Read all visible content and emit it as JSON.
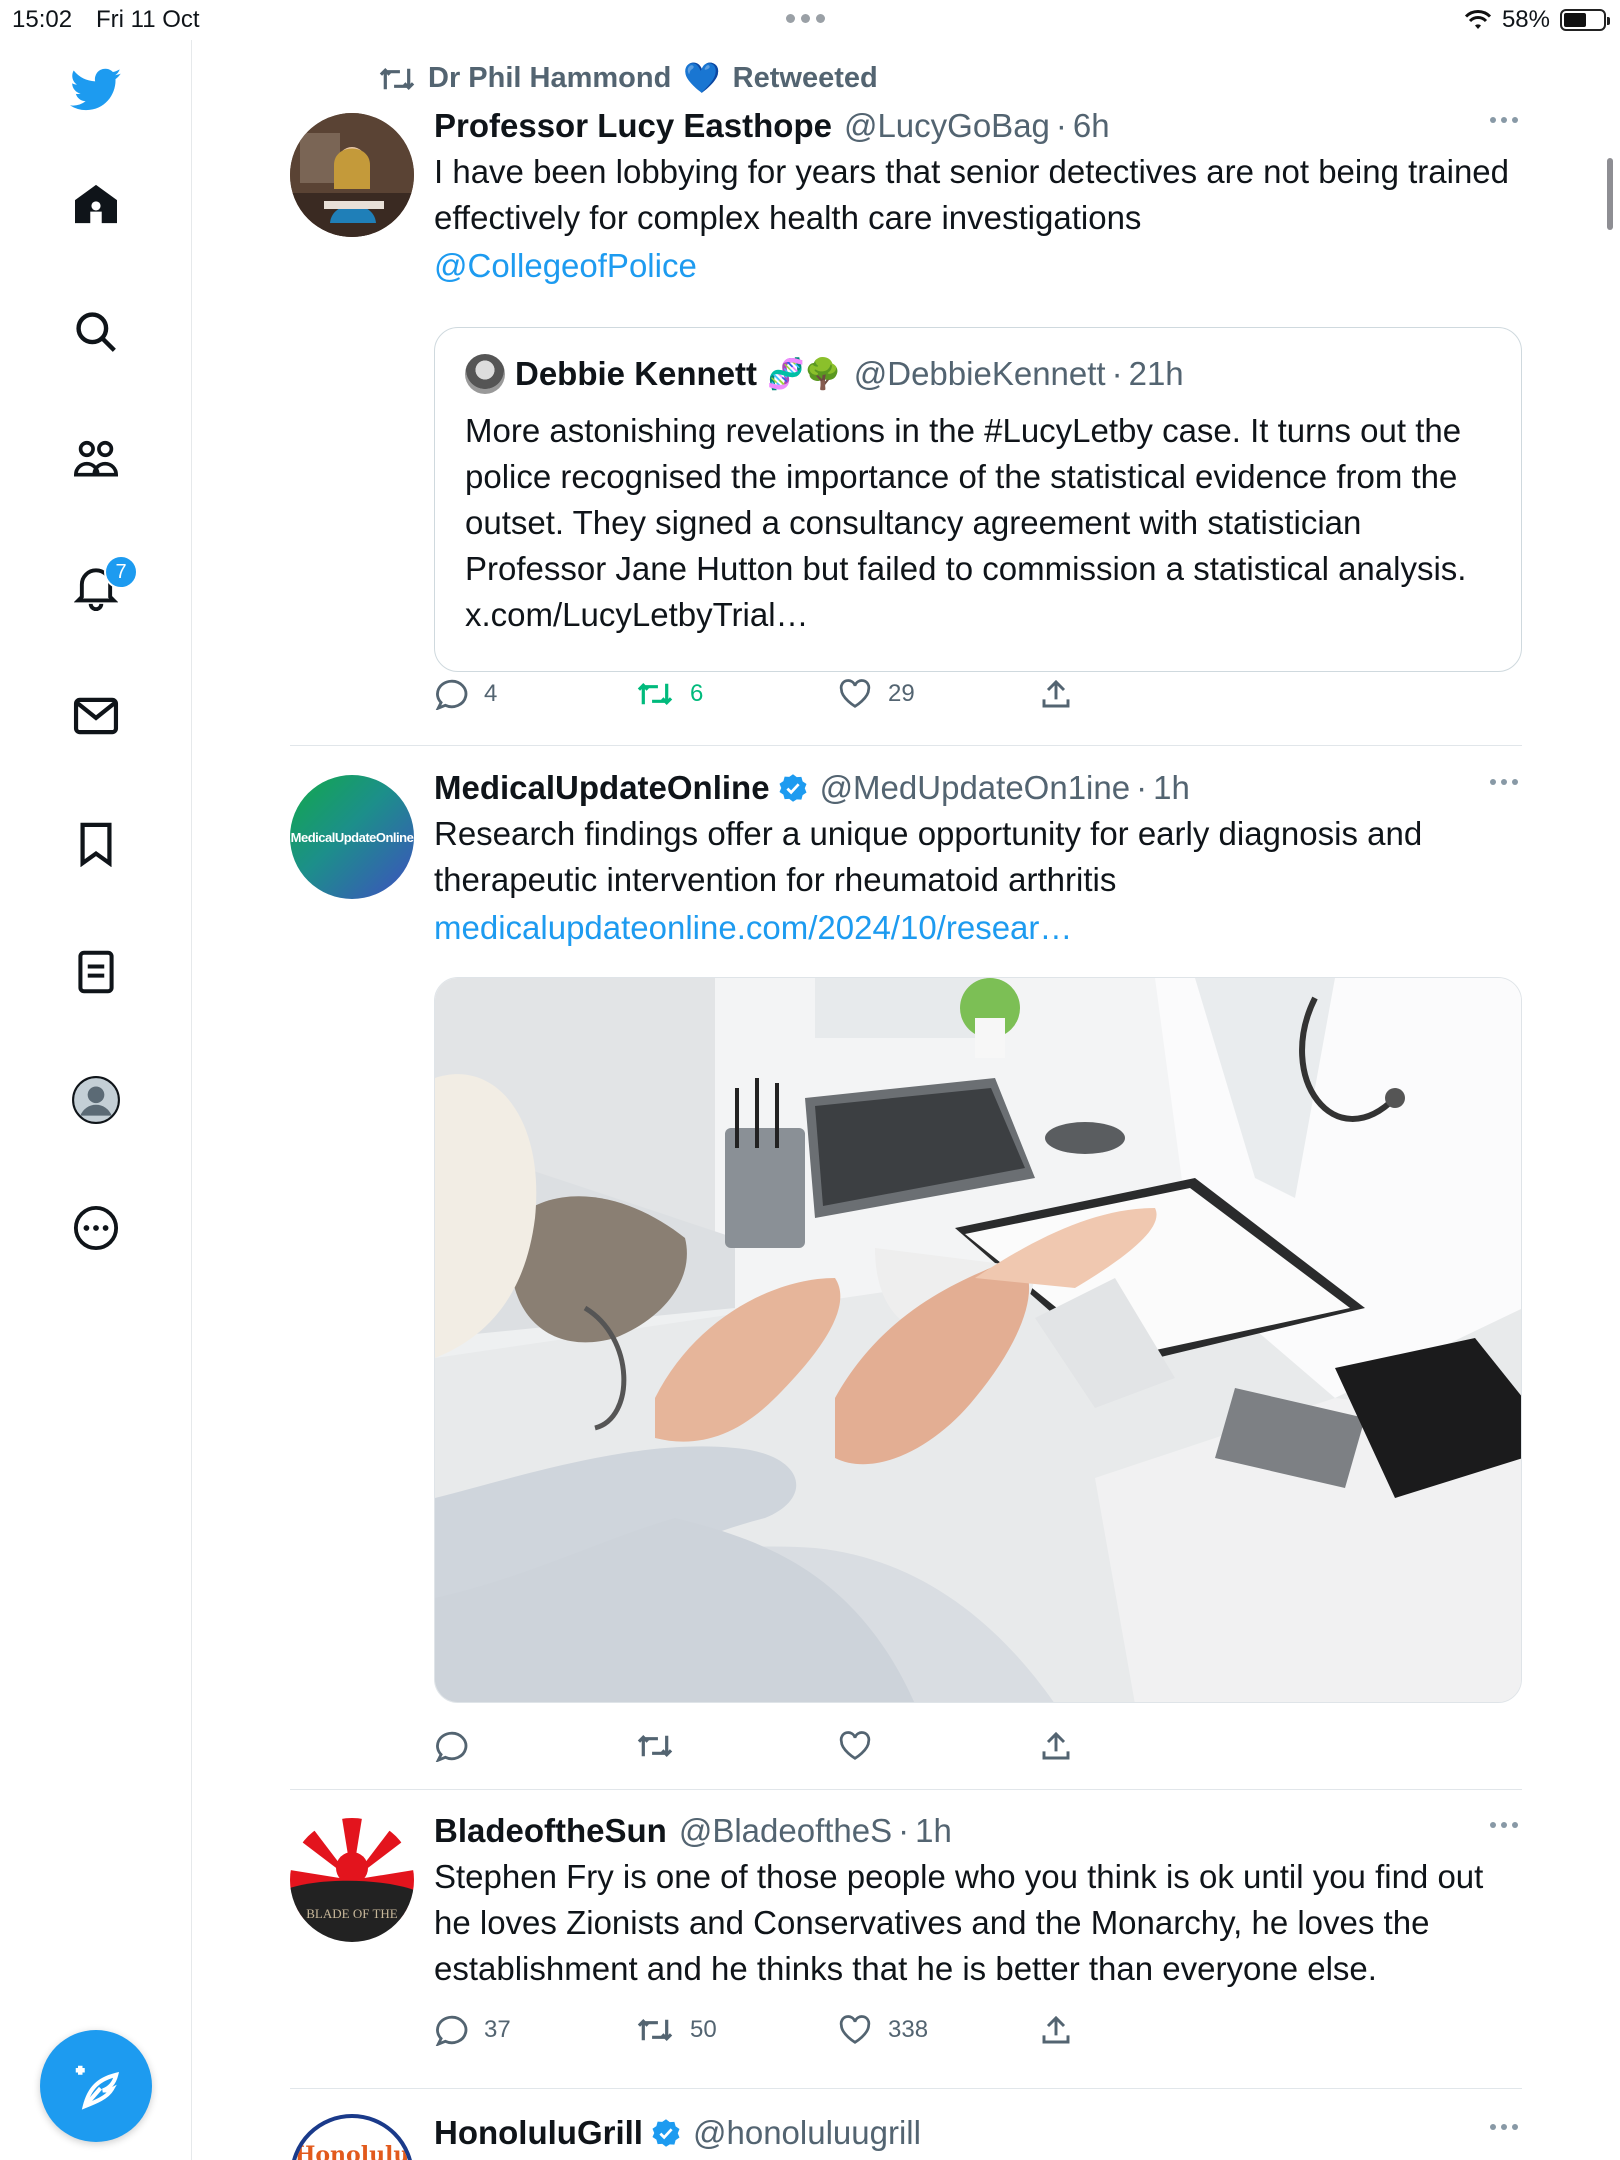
{
  "status_bar": {
    "time": "15:02",
    "date": "Fri 11 Oct",
    "battery": "58%",
    "battery_level": 0.58
  },
  "sidebar": {
    "items": [
      {
        "name": "home",
        "icon": "home-icon"
      },
      {
        "name": "explore",
        "icon": "search-icon"
      },
      {
        "name": "communities",
        "icon": "communities-icon"
      },
      {
        "name": "notifications",
        "icon": "bell-icon"
      },
      {
        "name": "messages",
        "icon": "envelope-icon"
      },
      {
        "name": "bookmarks",
        "icon": "bookmark-icon"
      },
      {
        "name": "lists",
        "icon": "list-icon"
      },
      {
        "name": "profile",
        "icon": "profile-avatar-icon"
      },
      {
        "name": "more",
        "icon": "more-circle-icon"
      }
    ],
    "notification_count": "7",
    "compose_icon": "compose-feather-icon"
  },
  "colors": {
    "accent": "#1d9bf0",
    "retweet_green": "#00ba7c",
    "muted": "#536471"
  },
  "tweets": [
    {
      "retweet_context": {
        "by": "Dr Phil Hammond",
        "label": "Retweeted"
      },
      "name": "Professor Lucy Easthope",
      "handle": "@LucyGoBag",
      "sep": "·",
      "time": "6h",
      "text": "I have been lobbying for years that senior detectives are not being trained effectively for complex health care investigations",
      "mention": "@CollegeofPolice",
      "quote": {
        "name": "Debbie Kennett",
        "emoji": "🧬🌳",
        "handle": "@DebbieKennett",
        "time": "21h",
        "text": "More astonishing revelations in the #LucyLetby case. It turns out the police recognised the importance of the statistical evidence from the outset. They signed a consultancy agreement with statistician Professor Jane Hutton but failed to commission a statistical analysis. x.com/LucyLetbyTrial…"
      },
      "replies": "4",
      "retweets": "6",
      "likes": "29"
    },
    {
      "name": "MedicalUpdateOnline",
      "handle": "@MedUpdateOn1ine",
      "sep": "·",
      "time": "1h",
      "avatar_text": "MedicalUpdateOnline",
      "text": "Research findings offer a unique opportunity for early diagnosis and therapeutic intervention for rheumatoid arthritis",
      "link": "medicalupdateonline.com/2024/10/resear…",
      "replies": "",
      "retweets": "",
      "likes": ""
    },
    {
      "name": "BladeoftheSun",
      "handle": "@BladeoftheS",
      "sep": "·",
      "time": "1h",
      "avatar_text": "BLADE OF THE",
      "text": "Stephen Fry is one of those people who you think is ok until you find out he loves Zionists and Conservatives and the Monarchy, he loves the establishment and he thinks that he is better than everyone else.",
      "replies": "37",
      "retweets": "50",
      "likes": "338"
    },
    {
      "name": "HonoluluGrill",
      "handle": "@honoluluugrill",
      "avatar_text": "Honolulu"
    }
  ]
}
